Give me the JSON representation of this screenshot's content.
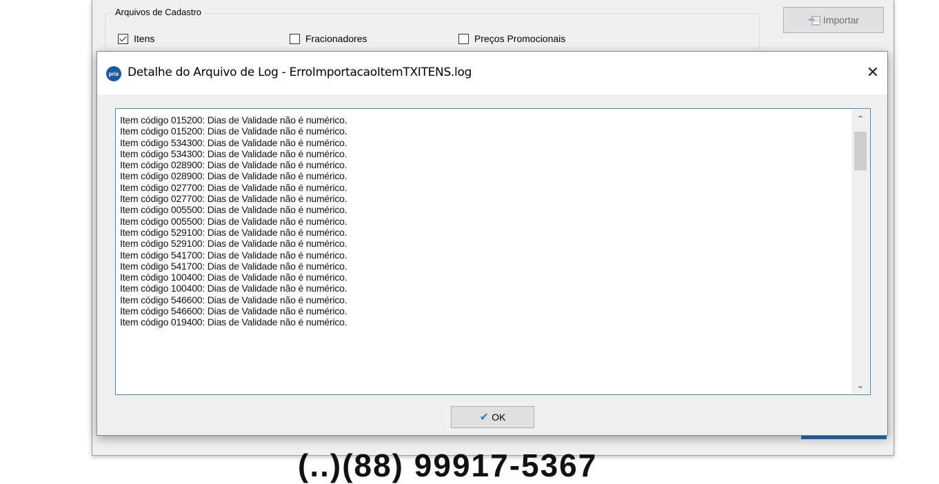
{
  "parent": {
    "group_title": "Arquivos de Cadastro",
    "checkboxes": [
      {
        "label": "Itens",
        "checked": true
      },
      {
        "label": "Fracionadores",
        "checked": false
      },
      {
        "label": "Preços Promocionais",
        "checked": false
      }
    ],
    "import_button": {
      "label": "Importar",
      "icon": "import-icon"
    },
    "partial_background_text": "(..)(88) 99917-5367"
  },
  "dialog": {
    "title": "Detalhe do Arquivo de Log - ErroImportacaoItemTXITENS.log",
    "app_icon_text": "prix",
    "close_symbol": "✕",
    "log_lines": [
      "Item código 015200: Dias de Validade não é numérico.",
      "Item código 015200: Dias de Validade não é numérico.",
      "Item código 534300: Dias de Validade não é numérico.",
      "Item código 534300: Dias de Validade não é numérico.",
      "Item código 028900: Dias de Validade não é numérico.",
      "Item código 028900: Dias de Validade não é numérico.",
      "Item código 027700: Dias de Validade não é numérico.",
      "Item código 027700: Dias de Validade não é numérico.",
      "Item código 005500: Dias de Validade não é numérico.",
      "Item código 005500: Dias de Validade não é numérico.",
      "Item código 529100: Dias de Validade não é numérico.",
      "Item código 529100: Dias de Validade não é numérico.",
      "Item código 541700: Dias de Validade não é numérico.",
      "Item código 541700: Dias de Validade não é numérico.",
      "Item código 100400: Dias de Validade não é numérico.",
      "Item código 100400: Dias de Validade não é numérico.",
      "Item código 546600: Dias de Validade não é numérico.",
      "Item código 546600: Dias de Validade não é numérico.",
      "Item código 019400: Dias de Validade não é numérico."
    ],
    "ok_button": {
      "label": "OK",
      "icon": "check-icon"
    }
  }
}
